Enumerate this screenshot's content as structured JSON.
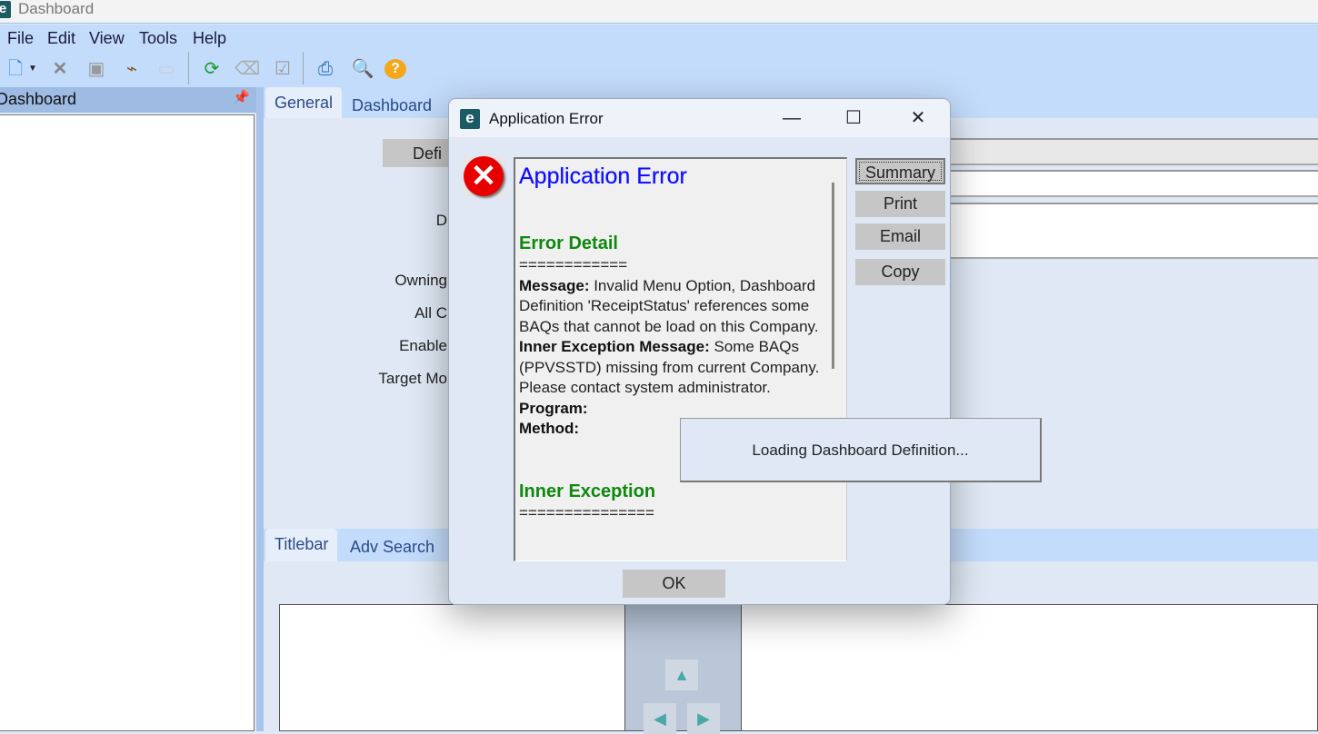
{
  "window": {
    "title": "Dashboard",
    "logo": "e"
  },
  "menu": [
    "File",
    "Edit",
    "View",
    "Tools",
    "Help"
  ],
  "toolbar": {
    "icons": [
      "new-icon",
      "dropdown-icon",
      "delete-icon",
      "save-icon",
      "clear-icon",
      "blank-icon",
      "refresh-icon",
      "eraser-icon",
      "checklist-icon",
      "print-icon",
      "print-preview-icon",
      "help-icon"
    ]
  },
  "left_pane": {
    "title": "Dashboard"
  },
  "tabs": [
    "General",
    "Dashboard"
  ],
  "form": {
    "definition_button": "Defi",
    "labels": [
      "D",
      "Owning",
      "All C",
      "Enable",
      "Target Mo"
    ]
  },
  "bottom_tabs": [
    "Titlebar",
    "Adv Search"
  ],
  "dialog": {
    "title": "Application Error",
    "heading": "Application Error",
    "error_detail": "Error Detail",
    "sep1": "============",
    "message_label": "Message:",
    "message": " Invalid Menu Option, Dashboard Definition 'ReceiptStatus' references some BAQs that cannot be load on this Company.",
    "inner_label": "Inner Exception Message:",
    "inner": " Some BAQs (PPVSSTD) missing from current Company.  Please contact system administrator.",
    "program_label": "Program:",
    "method_label": "Method:",
    "inner_exception": "Inner Exception",
    "sep2": "===============",
    "buttons": {
      "summary": "Summary",
      "print": "Print",
      "email": "Email",
      "copy": "Copy",
      "ok": "OK"
    }
  },
  "loading": "Loading Dashboard Definition..."
}
